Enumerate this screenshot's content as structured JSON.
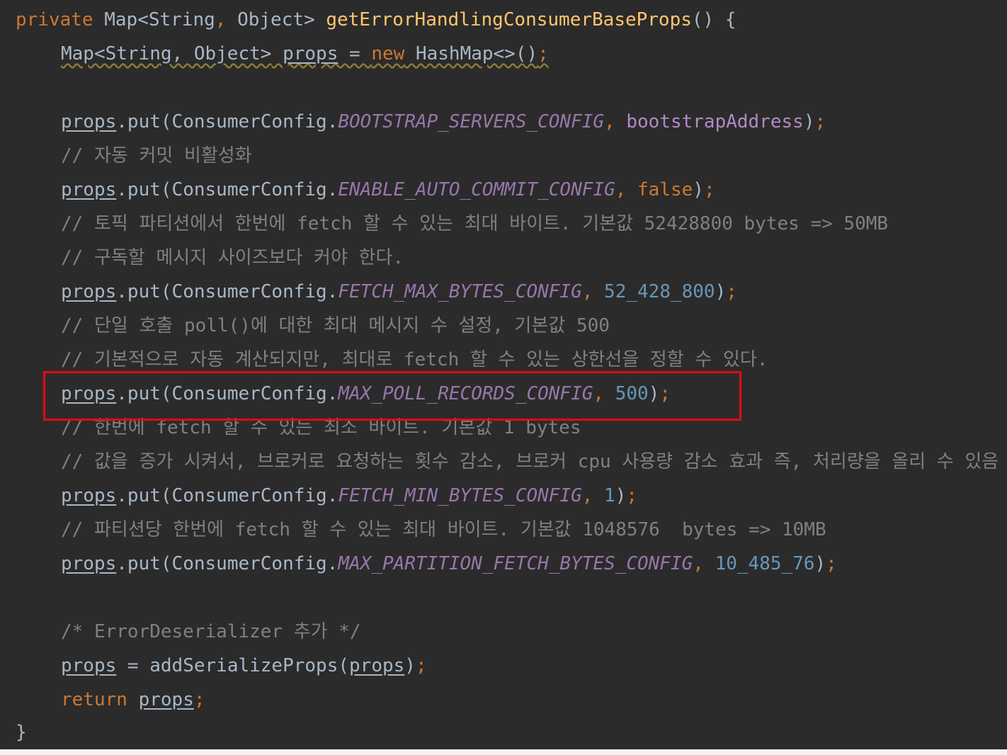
{
  "code": {
    "method_signature": {
      "modifier": "private",
      "return_type_pre": "Map<String",
      "comma": ",",
      "return_type_post": " Object>",
      "method_name": "getErrorHandlingConsumerBaseProps",
      "params_open": "() {"
    },
    "decl": {
      "type": "Map<String, Object>",
      "var": "props",
      "assign": " = ",
      "new_kw": "new",
      "ctor": " HashMap<>()",
      "semi": ";"
    },
    "put_prefix": ".put(ConsumerConfig.",
    "props_var": "props",
    "stmt_end": ");",
    "puts": [
      {
        "const": "BOOTSTRAP_SERVERS_CONFIG",
        "value": "bootstrapAddress",
        "value_kind": "var"
      },
      {
        "const": "ENABLE_AUTO_COMMIT_CONFIG",
        "value": "false",
        "value_kind": "kw"
      },
      {
        "const": "FETCH_MAX_BYTES_CONFIG",
        "value": "52_428_800",
        "value_kind": "num"
      },
      {
        "const": "MAX_POLL_RECORDS_CONFIG",
        "value": "500",
        "value_kind": "num"
      },
      {
        "const": "FETCH_MIN_BYTES_CONFIG",
        "value": "1",
        "value_kind": "num"
      },
      {
        "const": "MAX_PARTITION_FETCH_BYTES_CONFIG",
        "value": "10_485_76",
        "value_kind": "num"
      }
    ],
    "comments": {
      "auto_commit": "// 자동 커밋 비활성화",
      "fetch_max_1": "// 토픽 파티션에서 한번에 fetch 할 수 있는 최대 바이트. 기본값 52428800 bytes => 50MB",
      "fetch_max_2": "// 구독할 메시지 사이즈보다 커야 한다.",
      "poll_1": "// 단일 호출 poll()에 대한 최대 메시지 수 설정, 기본값 500",
      "poll_2": "// 기본적으로 자동 계산되지만, 최대로 fetch 할 수 있는 상한선을 정할 수 있다.",
      "fetch_min_1": "// 한번에 fetch 할 수 있는 최소 바이트. 기본값 1 bytes",
      "fetch_min_2": "// 값을 증가 시켜서, 브로커로 요청하는 횟수 감소, 브로커 cpu 사용량 감소 효과 즉, 처리량을 올리 수 있음",
      "partition": "// 파티션당 한번에 fetch 할 수 있는 최대 바이트. 기본값 1048576  bytes => 10MB",
      "error_deser": "/* ErrorDeserializer 추가 */"
    },
    "assign_line": {
      "var": "props",
      "eq": " = ",
      "call": "addSerializeProps(",
      "arg": "props",
      "close": ")",
      "semi": ";"
    },
    "return_line": {
      "kw": "return",
      "var": "props",
      "semi": ";"
    },
    "close_brace": "}"
  },
  "colors": {
    "background": "#2b2b2b",
    "keyword": "#cc7832",
    "function": "#ffc66d",
    "constant": "#9876aa",
    "number": "#6897bb",
    "comment": "#808080",
    "text": "#a9b7c6",
    "highlight_border": "#e30b0b"
  }
}
